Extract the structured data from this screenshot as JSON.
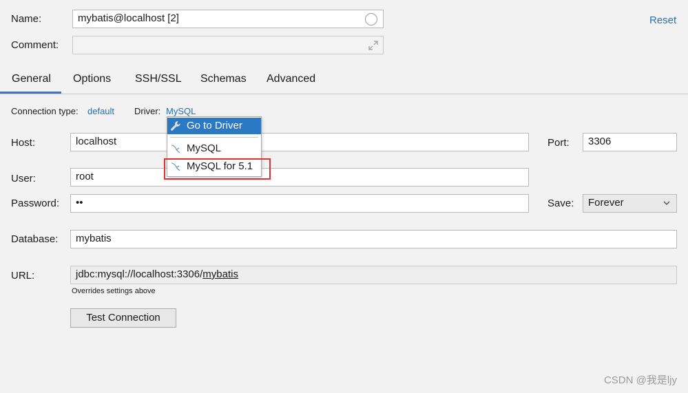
{
  "form": {
    "name_label": "Name:",
    "name_value": "mybatis@localhost [2]",
    "comment_label": "Comment:",
    "comment_value": "",
    "reset_label": "Reset"
  },
  "tabs": [
    {
      "label": "General",
      "active": true
    },
    {
      "label": "Options"
    },
    {
      "label": "SSH/SSL"
    },
    {
      "label": "Schemas"
    },
    {
      "label": "Advanced"
    }
  ],
  "connection": {
    "type_label": "Connection type:",
    "type_value": "default",
    "driver_label": "Driver:",
    "driver_value": "MySQL"
  },
  "driver_menu": {
    "items": [
      {
        "label": "Go to Driver",
        "icon": "wrench-icon"
      },
      {
        "label": "MySQL",
        "icon": "mysql-dolphin-icon"
      },
      {
        "label": "MySQL for 5.1",
        "icon": "mysql-dolphin-icon"
      }
    ]
  },
  "host": {
    "label": "Host:",
    "value": "localhost"
  },
  "port": {
    "label": "Port:",
    "value": "3306"
  },
  "user": {
    "label": "User:",
    "value": "root"
  },
  "password": {
    "label": "Password:",
    "value": "••"
  },
  "save": {
    "label": "Save:",
    "value": "Forever"
  },
  "database": {
    "label": "Database:",
    "value": "mybatis"
  },
  "url": {
    "label": "URL:",
    "value_prefix": "jdbc:mysql://localhost:3306/",
    "value_db": "mybatis",
    "note": "Overrides settings above"
  },
  "test_button": "Test Connection",
  "watermark": "CSDN @我是ljy",
  "colors": {
    "accent": "#2470b8",
    "selection": "#2b78c5",
    "highlight": "#e03030"
  }
}
